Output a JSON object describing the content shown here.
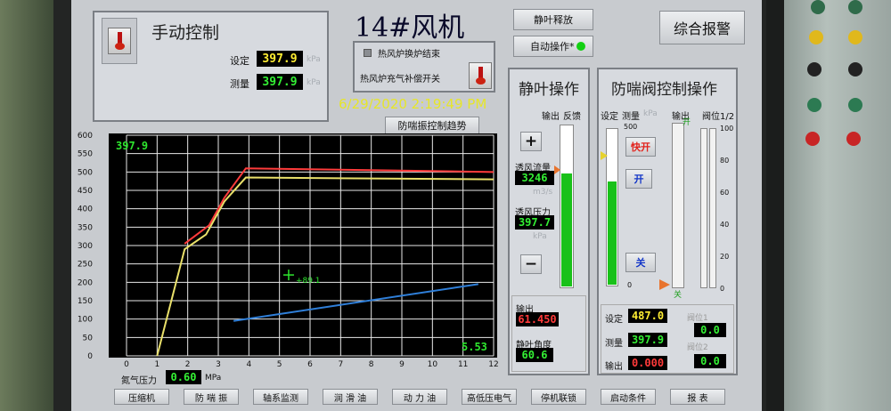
{
  "manual": {
    "title": "手动控制",
    "set_label": "设定",
    "set_value": "397.9",
    "meas_label": "测量",
    "meas_value": "397.9",
    "unit": "kPa"
  },
  "header": {
    "title": "14#风机",
    "datetime": "6/29/2020 2:19:49 PM",
    "trend_button": "防喘振控制趋势"
  },
  "hotblast": {
    "end_label": "热风炉换炉结束",
    "switch_label": "热风炉充气补偿开关"
  },
  "top_buttons": {
    "release": "静叶释放",
    "auto": "自动操作*",
    "alarm": "综合报警"
  },
  "chart_data": {
    "type": "line",
    "x_ticks": [
      "0",
      "1",
      "2",
      "3",
      "4",
      "5",
      "6",
      "7",
      "8",
      "9",
      "10",
      "11",
      "12"
    ],
    "y_ticks": [
      "0",
      "50",
      "100",
      "150",
      "200",
      "250",
      "300",
      "350",
      "400",
      "450",
      "500",
      "550",
      "600"
    ],
    "xlim": [
      0,
      12
    ],
    "ylim": [
      0,
      600
    ],
    "readout_top": "397.9",
    "readout_bottom": "5.53",
    "cursor_label": "+89.1",
    "series": [
      {
        "color": "#ff3b3b",
        "x": [
          1.9,
          2.7,
          3.2,
          3.9,
          12
        ],
        "y": [
          305,
          355,
          430,
          510,
          500
        ]
      },
      {
        "color": "#e9e06a",
        "x": [
          1.0,
          1.9,
          2.6,
          3.2,
          3.9,
          12
        ],
        "y": [
          0,
          290,
          330,
          420,
          485,
          480
        ]
      },
      {
        "color": "#2f7fd9",
        "x": [
          3.5,
          11.5
        ],
        "y": [
          95,
          195
        ]
      }
    ],
    "cursor": {
      "x": 5.3,
      "y": 220
    }
  },
  "n2": {
    "label": "氮气压力",
    "value": "0.60",
    "unit": "MPa"
  },
  "static": {
    "title": "静叶操作",
    "output_label": "输出",
    "feedback_label": "反馈",
    "plus": "+",
    "minus": "−",
    "flow_label": "透风流量",
    "flow_value": "3246",
    "flow_unit": "m3/s",
    "press_label": "透风压力",
    "press_value": "397.7",
    "press_unit": "kPa",
    "out_label": "输出",
    "out_value": "61.450",
    "angle_label": "静叶角度",
    "angle_value": "60.6",
    "feedback_fill": 0.7
  },
  "antisurge": {
    "title": "防喘阀控制操作",
    "hdr_set": "设定",
    "hdr_meas": "测量",
    "hdr_unit": "kPa",
    "hdr_out": "输出",
    "hdr_pos": "阀位1/2",
    "scale_left": [
      "500",
      "0"
    ],
    "scale_right": [
      "100",
      "80",
      "60",
      "40",
      "20",
      "0"
    ],
    "open_mark": "开",
    "close_mark": "关",
    "fast_open": "快开",
    "open": "开",
    "close": "关",
    "set_label": "设定",
    "set_value": "487.0",
    "meas_label": "测量",
    "meas_value": "397.9",
    "out_label": "输出",
    "out_value": "0.000",
    "pos1_label": "阀位1",
    "pos1_value": "0.0",
    "pos2_label": "阀位2",
    "pos2_value": "0.0",
    "meas_fill": 0.66
  },
  "bottom_tabs": [
    "压缩机",
    "防 喘 振",
    "轴系监测",
    "润 滑 油",
    "动 力 油",
    "高低压电气",
    "停机联锁",
    "启动条件",
    "报  表"
  ]
}
